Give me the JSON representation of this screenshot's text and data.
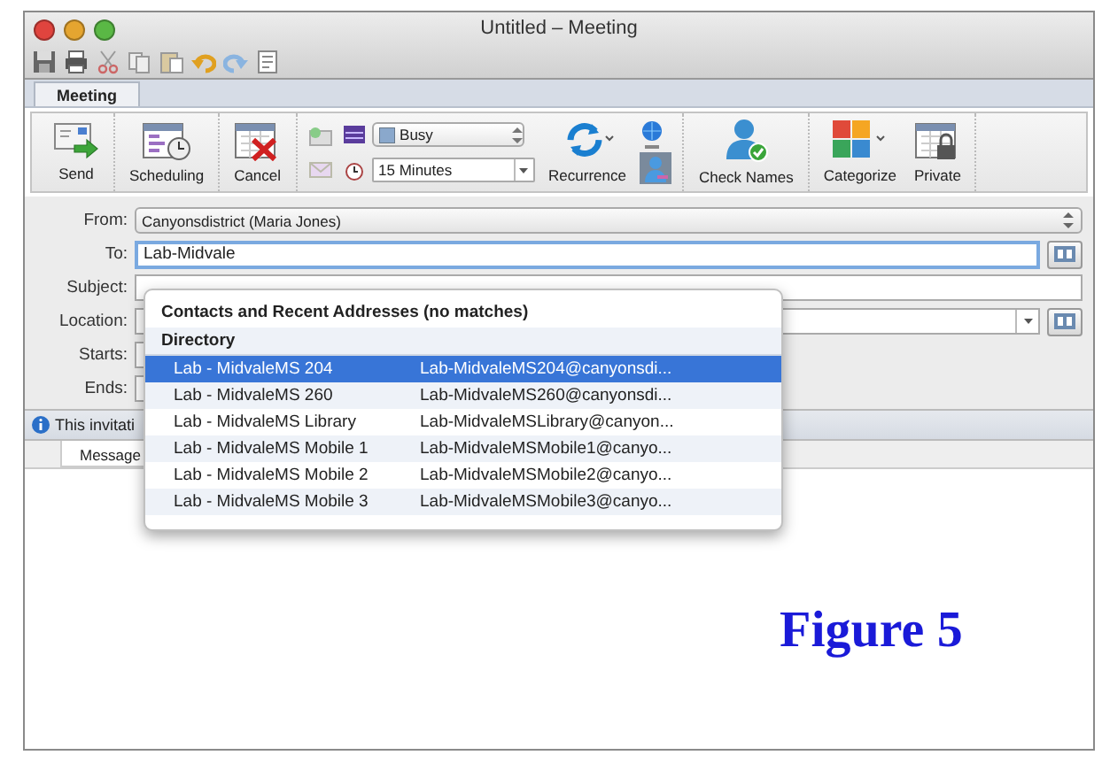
{
  "window": {
    "title": "Untitled – Meeting"
  },
  "ribbon_tab": {
    "label": "Meeting",
    "selected": true
  },
  "ribbon": {
    "buttons": [
      {
        "kind": "send",
        "label": "Send"
      },
      {
        "kind": "scheduling",
        "label": "Scheduling"
      },
      {
        "kind": "cancel",
        "label": "Cancel"
      },
      {
        "kind": "options",
        "show_as": "Busy",
        "reminder": "15 Minutes"
      },
      {
        "kind": "recurrence",
        "label": "Recurrence"
      },
      {
        "kind": "check-names",
        "label": "Check Names"
      },
      {
        "kind": "categorize",
        "label": "Categorize"
      },
      {
        "kind": "private",
        "label": "Private"
      }
    ]
  },
  "form": {
    "fields": [
      {
        "kind": "select",
        "label": "From:",
        "value": "Canyonsdistrict (Maria Jones)"
      },
      {
        "kind": "address",
        "label": "To:",
        "value": "Lab-Midvale",
        "focused": true
      },
      {
        "kind": "text",
        "label": "Subject:"
      },
      {
        "kind": "combo",
        "label": "Location:"
      },
      {
        "kind": "date",
        "label": "Starts:"
      },
      {
        "kind": "date",
        "label": "Ends:"
      }
    ]
  },
  "info_bar": {
    "text": "This invitati"
  },
  "message_tabs": [
    {
      "label": "Message",
      "selected": true
    }
  ],
  "autocomplete": {
    "heading": "Contacts and Recent Addresses (no matches)",
    "section": "Directory",
    "items": [
      {
        "name": "Lab - MidvaleMS 204",
        "email": "Lab-MidvaleMS204@canyonsdi...",
        "selected": true
      },
      {
        "name": "Lab - MidvaleMS 260",
        "email": "Lab-MidvaleMS260@canyonsdi...",
        "selected": false
      },
      {
        "name": "Lab - MidvaleMS Library",
        "email": "Lab-MidvaleMSLibrary@canyon...",
        "selected": false
      },
      {
        "name": "Lab - MidvaleMS Mobile 1",
        "email": "Lab-MidvaleMSMobile1@canyo...",
        "selected": false
      },
      {
        "name": "Lab - MidvaleMS Mobile 2",
        "email": "Lab-MidvaleMSMobile2@canyo...",
        "selected": false
      },
      {
        "name": "Lab - MidvaleMS Mobile 3",
        "email": "Lab-MidvaleMSMobile3@canyo...",
        "selected": false
      }
    ]
  },
  "caption": {
    "text": "Figure 5"
  }
}
